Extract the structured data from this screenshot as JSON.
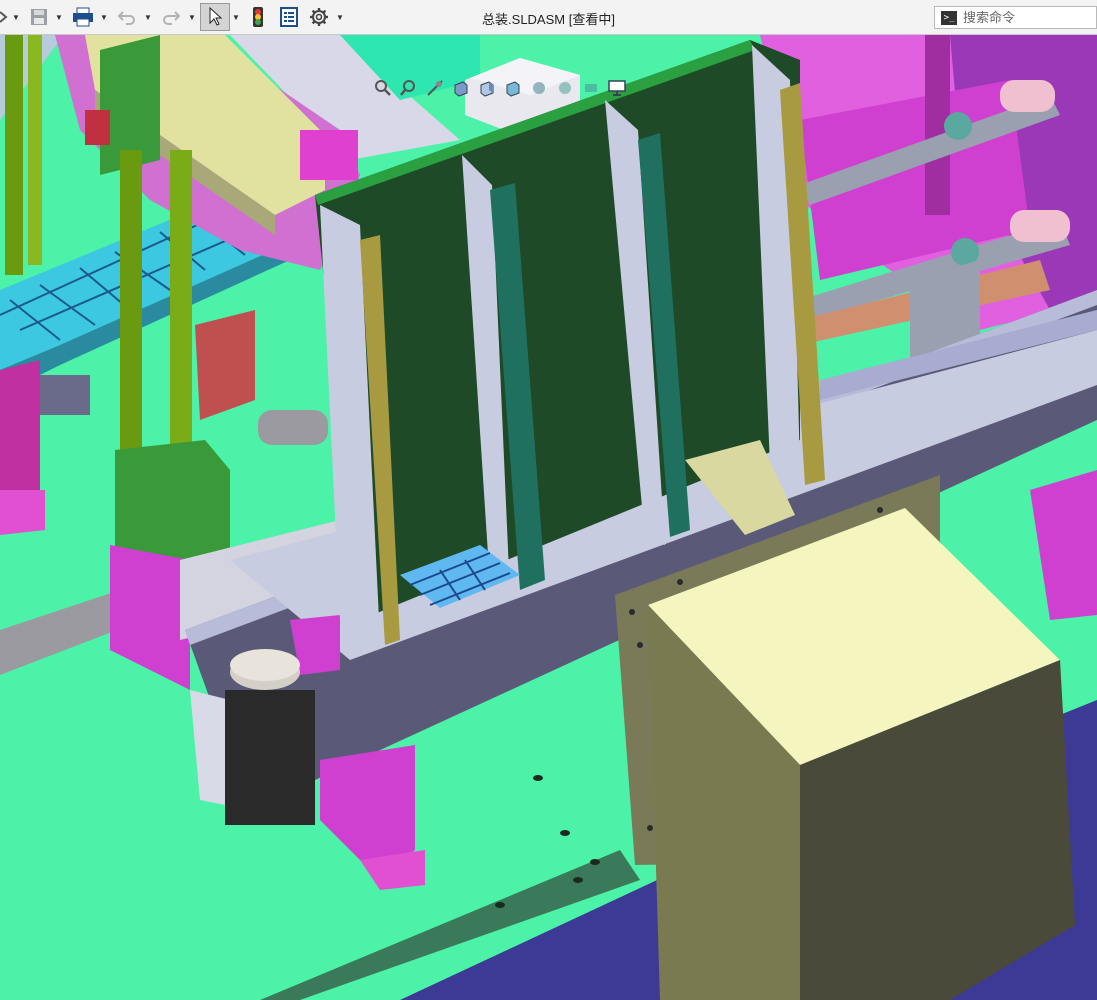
{
  "window": {
    "title": "总装.SLDASM [查看中]"
  },
  "toolbar": {
    "icons": [
      "open-icon",
      "save-icon",
      "print-icon",
      "undo-icon",
      "redo-icon",
      "select-icon",
      "rebuild-icon",
      "file-properties-icon",
      "options-icon"
    ]
  },
  "search": {
    "placeholder": "搜索命令"
  },
  "view_toolbar": {
    "icons": [
      "zoom-to-fit-icon",
      "zoom-to-area-icon",
      "previous-view-icon",
      "section-view-icon",
      "view-orientation-icon",
      "display-style-icon",
      "hide-show-icon",
      "edit-appearance-icon",
      "apply-scene-icon",
      "view-settings-icon"
    ]
  },
  "colors": {
    "floor": "#4cf2a8",
    "frame": "#5a5a78",
    "plate": "#1e4a28",
    "magenta": "#d040d0",
    "motor_box": "#f5f5c0",
    "blue_base": "#4040a0"
  }
}
